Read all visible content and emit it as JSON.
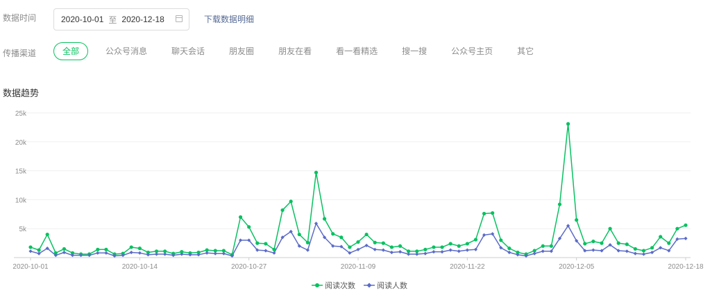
{
  "filters": {
    "time_label": "数据时间",
    "start_date": "2020-10-01",
    "separator": "至",
    "end_date": "2020-12-18",
    "download_label": "下载数据明细",
    "channel_label": "传播渠道",
    "channels": [
      "全部",
      "公众号消息",
      "聊天会话",
      "朋友圈",
      "朋友在看",
      "看一看精选",
      "搜一搜",
      "公众号主页",
      "其它"
    ],
    "active_channel": "全部"
  },
  "section_title": "数据趋势",
  "icons": {
    "date_picker": "calendar-icon"
  },
  "colors": {
    "accent": "#07c160",
    "series1": "#07c160",
    "series2": "#5b6bc8",
    "link": "#576b95"
  },
  "chart_data": {
    "type": "line",
    "start_date": "2020-10-01",
    "end_date": "2020-12-18",
    "x_ticks": [
      "2020-10-01",
      "2020-10-14",
      "2020-10-27",
      "2020-11-09",
      "2020-11-22",
      "2020-12-05",
      "2020-12-18"
    ],
    "y_ticks": [
      "5k",
      "10k",
      "15k",
      "20k",
      "25k"
    ],
    "ylim": [
      0,
      25000
    ],
    "grid": true,
    "legend": "bottom-center",
    "series": [
      {
        "name": "阅读次数",
        "color": "#07c160",
        "marker": "circle",
        "values": [
          1800,
          1300,
          4000,
          800,
          1500,
          800,
          600,
          600,
          1400,
          1400,
          600,
          700,
          1800,
          1600,
          900,
          1100,
          1100,
          700,
          1000,
          800,
          900,
          1300,
          1200,
          1200,
          500,
          7000,
          5300,
          2500,
          2400,
          1400,
          8200,
          9700,
          4000,
          2600,
          14700,
          6700,
          4100,
          3500,
          1800,
          2700,
          4000,
          2600,
          2500,
          1800,
          2000,
          1100,
          1100,
          1400,
          1800,
          1800,
          2400,
          2000,
          2400,
          3100,
          7600,
          7700,
          3000,
          1600,
          900,
          600,
          1200,
          2000,
          2000,
          9200,
          23100,
          6500,
          2400,
          2800,
          2500,
          5000,
          2500,
          2300,
          1500,
          1200,
          1700,
          3600,
          2500,
          5000,
          5600
        ]
      },
      {
        "name": "阅读人数",
        "color": "#5b6bc8",
        "marker": "diamond",
        "values": [
          1100,
          700,
          1600,
          400,
          900,
          400,
          400,
          400,
          800,
          800,
          300,
          400,
          900,
          800,
          500,
          600,
          600,
          400,
          600,
          500,
          500,
          800,
          700,
          700,
          300,
          3000,
          3000,
          1300,
          1200,
          800,
          3500,
          4500,
          2000,
          1300,
          5900,
          3500,
          2000,
          1900,
          800,
          1400,
          2100,
          1400,
          1300,
          900,
          1000,
          600,
          600,
          700,
          1000,
          1000,
          1300,
          1100,
          1300,
          1400,
          3900,
          4100,
          1700,
          900,
          500,
          300,
          700,
          1100,
          1100,
          3300,
          5500,
          2900,
          1200,
          1300,
          1200,
          2200,
          1200,
          1100,
          700,
          600,
          900,
          1700,
          1200,
          3200,
          3300
        ]
      }
    ]
  }
}
